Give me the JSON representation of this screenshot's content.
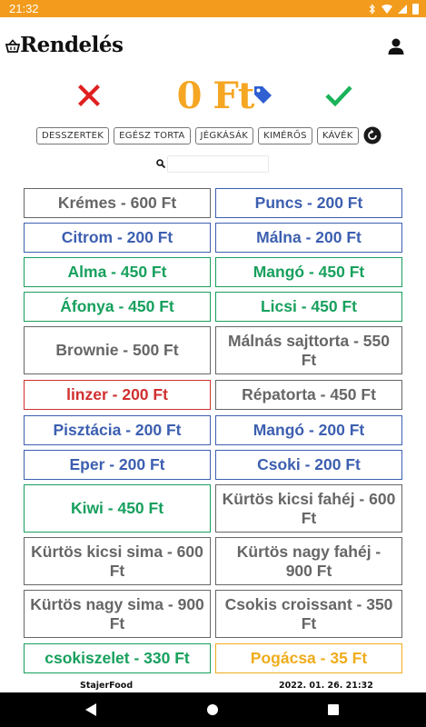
{
  "status_bar": {
    "time": "21:32",
    "icons": [
      "bluetooth-icon",
      "wifi-icon",
      "signal-icon",
      "battery-icon"
    ],
    "background": "#f29b1c"
  },
  "app_bar": {
    "title": "Rendelés",
    "home_icon": "shopping-basket-icon",
    "account_icon": "person-icon"
  },
  "order": {
    "total": "0 Ft",
    "cancel_icon": "close-icon",
    "discount_icon": "price-tag-icon",
    "confirm_icon": "check-icon",
    "colors": {
      "cancel": "#e02020",
      "total": "#f5a623",
      "tag": "#2f5fd0",
      "confirm": "#19b35a"
    }
  },
  "categories": [
    "DESSZERTEK",
    "EGÉSZ TORTA",
    "JÉGKÁSÁK",
    "KIMÉRŐS",
    "KÁVÉK"
  ],
  "refresh_icon": "refresh-icon",
  "search": {
    "icon": "search-icon",
    "value": "",
    "placeholder": ""
  },
  "colors": {
    "gray": "#666666",
    "blue": "#3d5fb0",
    "green": "#17a05d",
    "red": "#d03030",
    "orange": "#f0ac1c"
  },
  "products": [
    {
      "label": "Krémes - 600 Ft",
      "color": "gray"
    },
    {
      "label": "Puncs - 200 Ft",
      "color": "blue"
    },
    {
      "label": "Citrom - 200 Ft",
      "color": "blue"
    },
    {
      "label": "Málna - 200 Ft",
      "color": "blue"
    },
    {
      "label": "Alma - 450 Ft",
      "color": "green"
    },
    {
      "label": "Mangó - 450 Ft",
      "color": "green"
    },
    {
      "label": "Áfonya - 450 Ft",
      "color": "green"
    },
    {
      "label": "Licsi - 450 Ft",
      "color": "green"
    },
    {
      "label": "Brownie - 500 Ft",
      "color": "gray"
    },
    {
      "label": "Málnás sajttorta - 550 Ft",
      "color": "gray"
    },
    {
      "label": "linzer - 200 Ft",
      "color": "red"
    },
    {
      "label": "Répatorta - 450 Ft",
      "color": "gray"
    },
    {
      "label": "Pisztácia - 200 Ft",
      "color": "blue"
    },
    {
      "label": "Mangó - 200 Ft",
      "color": "blue"
    },
    {
      "label": "Eper - 200 Ft",
      "color": "blue"
    },
    {
      "label": "Csoki - 200 Ft",
      "color": "blue"
    },
    {
      "label": "Kiwi - 450 Ft",
      "color": "green"
    },
    {
      "label": "Kürtös kicsi fahéj - 600 Ft",
      "color": "gray"
    },
    {
      "label": "Kürtös kicsi sima - 600 Ft",
      "color": "gray"
    },
    {
      "label": "Kürtös nagy fahéj - 900 Ft",
      "color": "gray"
    },
    {
      "label": "Kürtös nagy sima - 900 Ft",
      "color": "gray"
    },
    {
      "label": "Csokis croissant - 350 Ft",
      "color": "gray"
    },
    {
      "label": "csokiszelet - 330 Ft",
      "color": "green"
    },
    {
      "label": "Pogácsa - 35 Ft",
      "color": "orange"
    }
  ],
  "footer": {
    "brand": "StajerFood",
    "datetime": "2022. 01. 26. 21:32"
  },
  "nav_bar": {
    "back_icon": "back-icon",
    "home_icon": "home-icon",
    "recents_icon": "recents-icon"
  }
}
